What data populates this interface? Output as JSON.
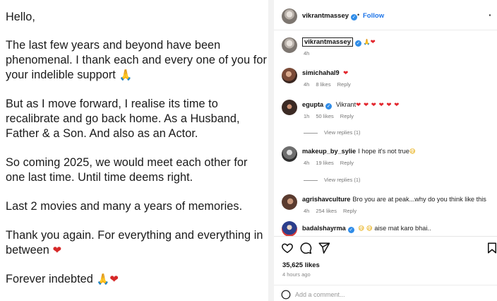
{
  "letter": {
    "greeting": "Hello,",
    "p1": "The last few years and beyond have been phenomenal. I thank each and every one of you for your indelible support",
    "p2": "But as I move forward, I realise its time to recalibrate and go back home. As a Husband, Father & a Son. And also as an Actor.",
    "p3": "So coming 2025, we would meet each other for one last time. Until time deems right.",
    "p4": "Last 2 movies and many a years of memories.",
    "p5": "Thank you again. For everything and everything in between",
    "p6": "Forever indebted"
  },
  "post": {
    "author": "vikrantmassey",
    "bullet": "•",
    "follow_label": "Follow",
    "more_label": "·",
    "caption_user": "vikrantmassey",
    "caption_time": "4h",
    "likes": "35,625 likes",
    "time_ago": "4 hours ago",
    "add_comment_placeholder": "Add a comment..."
  },
  "comments": [
    {
      "user": "simichahal9",
      "text": "",
      "time": "4h",
      "likes": "8 likes",
      "reply": "Reply"
    },
    {
      "user": "egupta",
      "text": "Vikrant",
      "time": "1h",
      "likes": "50 likes",
      "reply": "Reply",
      "view_replies": "View replies (1)"
    },
    {
      "user": "makeup_by_sylie",
      "text": "I hope it's not true",
      "time": "4h",
      "likes": "19 likes",
      "reply": "Reply",
      "view_replies": "View replies (1)"
    },
    {
      "user": "agrishavculture",
      "text": "Bro you are at peak...why do you think like this",
      "time": "4h",
      "likes": "254 likes",
      "reply": "Reply"
    },
    {
      "user": "badalshayrma",
      "text": "aise mat karo bhai..",
      "time": "",
      "likes": "",
      "reply": ""
    }
  ],
  "icons": [
    "heart-icon",
    "comment-icon",
    "share-icon",
    "bookmark-icon",
    "verified-icon",
    "emoji-icon"
  ],
  "colors": {
    "follow": "#1d74e8",
    "verified": "#2f8ce8",
    "heart": "#e3262d"
  }
}
